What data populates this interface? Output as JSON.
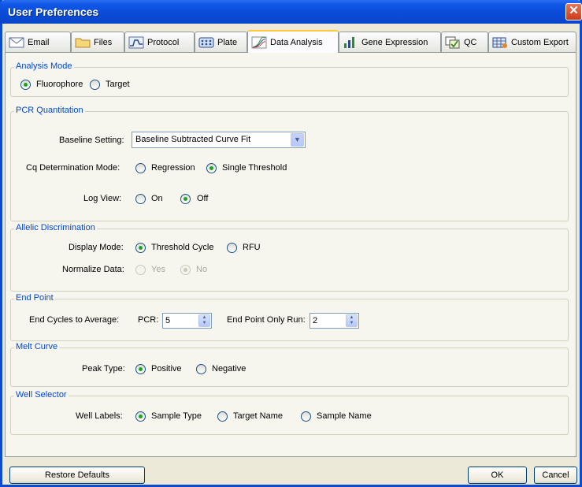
{
  "window": {
    "title": "User Preferences",
    "close_glyph": "✕"
  },
  "tabs": [
    {
      "label": "Email",
      "icon": "email-icon"
    },
    {
      "label": "Files",
      "icon": "folder-icon"
    },
    {
      "label": "Protocol",
      "icon": "protocol-icon"
    },
    {
      "label": "Plate",
      "icon": "plate-icon"
    },
    {
      "label": "Data Analysis",
      "icon": "data-analysis-icon",
      "active": true
    },
    {
      "label": "Gene Expression",
      "icon": "gene-expression-icon"
    },
    {
      "label": "QC",
      "icon": "qc-icon"
    },
    {
      "label": "Custom Export",
      "icon": "custom-export-icon"
    }
  ],
  "analysis_mode": {
    "title": "Analysis Mode",
    "options": [
      "Fluorophore",
      "Target"
    ],
    "selected": "Fluorophore"
  },
  "pcr_quantitation": {
    "title": "PCR Quantitation",
    "baseline_label": "Baseline Setting:",
    "baseline_value": "Baseline Subtracted Curve Fit",
    "cq_label": "Cq Determination Mode:",
    "cq_options": [
      "Regression",
      "Single Threshold"
    ],
    "cq_selected": "Single Threshold",
    "log_label": "Log View:",
    "log_options": [
      "On",
      "Off"
    ],
    "log_selected": "Off"
  },
  "allelic_discrimination": {
    "title": "Allelic Discrimination",
    "display_label": "Display Mode:",
    "display_options": [
      "Threshold Cycle",
      "RFU"
    ],
    "display_selected": "Threshold Cycle",
    "normalize_label": "Normalize Data:",
    "normalize_options": [
      "Yes",
      "No"
    ],
    "normalize_selected": "No"
  },
  "end_point": {
    "title": "End Point",
    "cycles_label": "End Cycles to Average:",
    "pcr_label": "PCR:",
    "pcr_value": "5",
    "run_label": "End Point Only Run:",
    "run_value": "2"
  },
  "melt_curve": {
    "title": "Melt Curve",
    "peak_label": "Peak Type:",
    "options": [
      "Positive",
      "Negative"
    ],
    "selected": "Positive"
  },
  "well_selector": {
    "title": "Well Selector",
    "labels_label": "Well Labels:",
    "options": [
      "Sample Type",
      "Target Name",
      "Sample Name"
    ],
    "selected": "Sample Type"
  },
  "buttons": {
    "restore": "Restore Defaults",
    "ok": "OK",
    "cancel": "Cancel"
  }
}
